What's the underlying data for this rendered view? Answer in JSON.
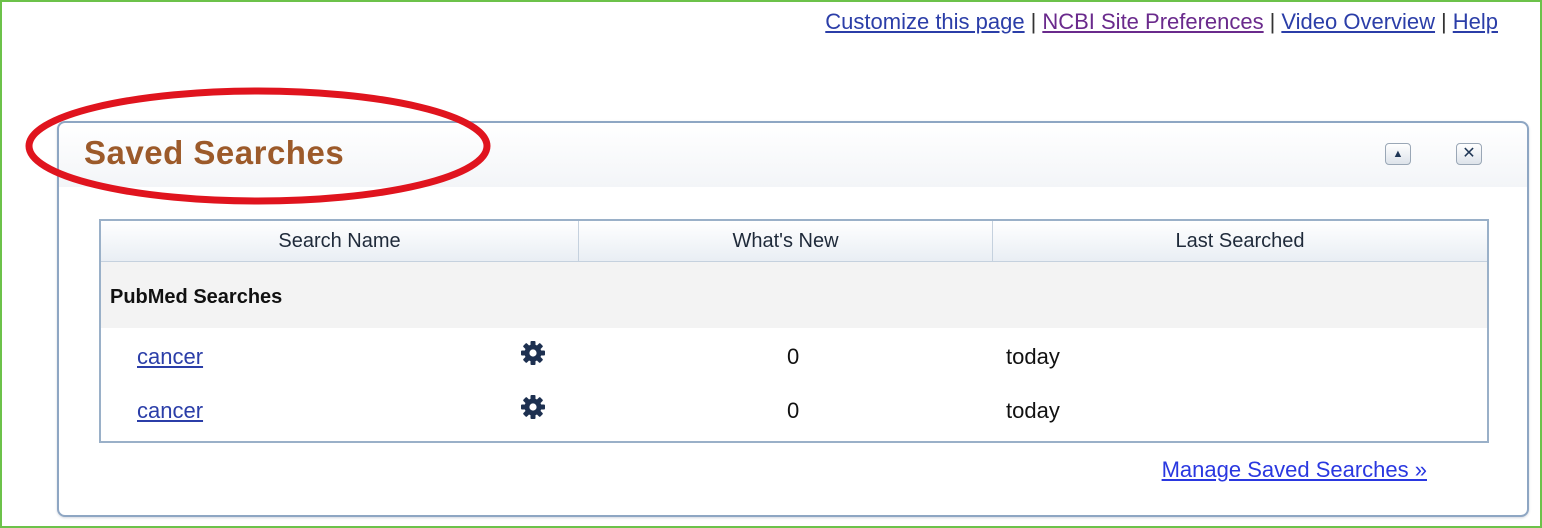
{
  "top_links": [
    {
      "label": "Customize this page"
    },
    {
      "label": "NCBI Site Preferences"
    },
    {
      "label": "Video Overview"
    },
    {
      "label": "Help"
    }
  ],
  "separator": "|",
  "portlet": {
    "title": "Saved Searches",
    "collapse_icon": "triangle-up-icon",
    "close_icon": "close-icon",
    "collapse_glyph": "▲",
    "close_glyph": "✕",
    "highlight_color": "#e0141e"
  },
  "table": {
    "headers": [
      "Search Name",
      "What's New",
      "Last Searched"
    ],
    "group_label": "PubMed Searches",
    "rows": [
      {
        "name": "cancer",
        "icon": "gear-icon",
        "whats_new": "0",
        "last_searched": "today"
      },
      {
        "name": "cancer",
        "icon": "gear-icon",
        "whats_new": "0",
        "last_searched": "today"
      }
    ]
  },
  "manage_link": "Manage Saved Searches »",
  "colors": {
    "link": "#2b3ea8",
    "visited_link": "#6a2a8c",
    "title": "#9c5a2a",
    "frame": "#6cc24a",
    "portlet_border": "#8ea6c3"
  }
}
